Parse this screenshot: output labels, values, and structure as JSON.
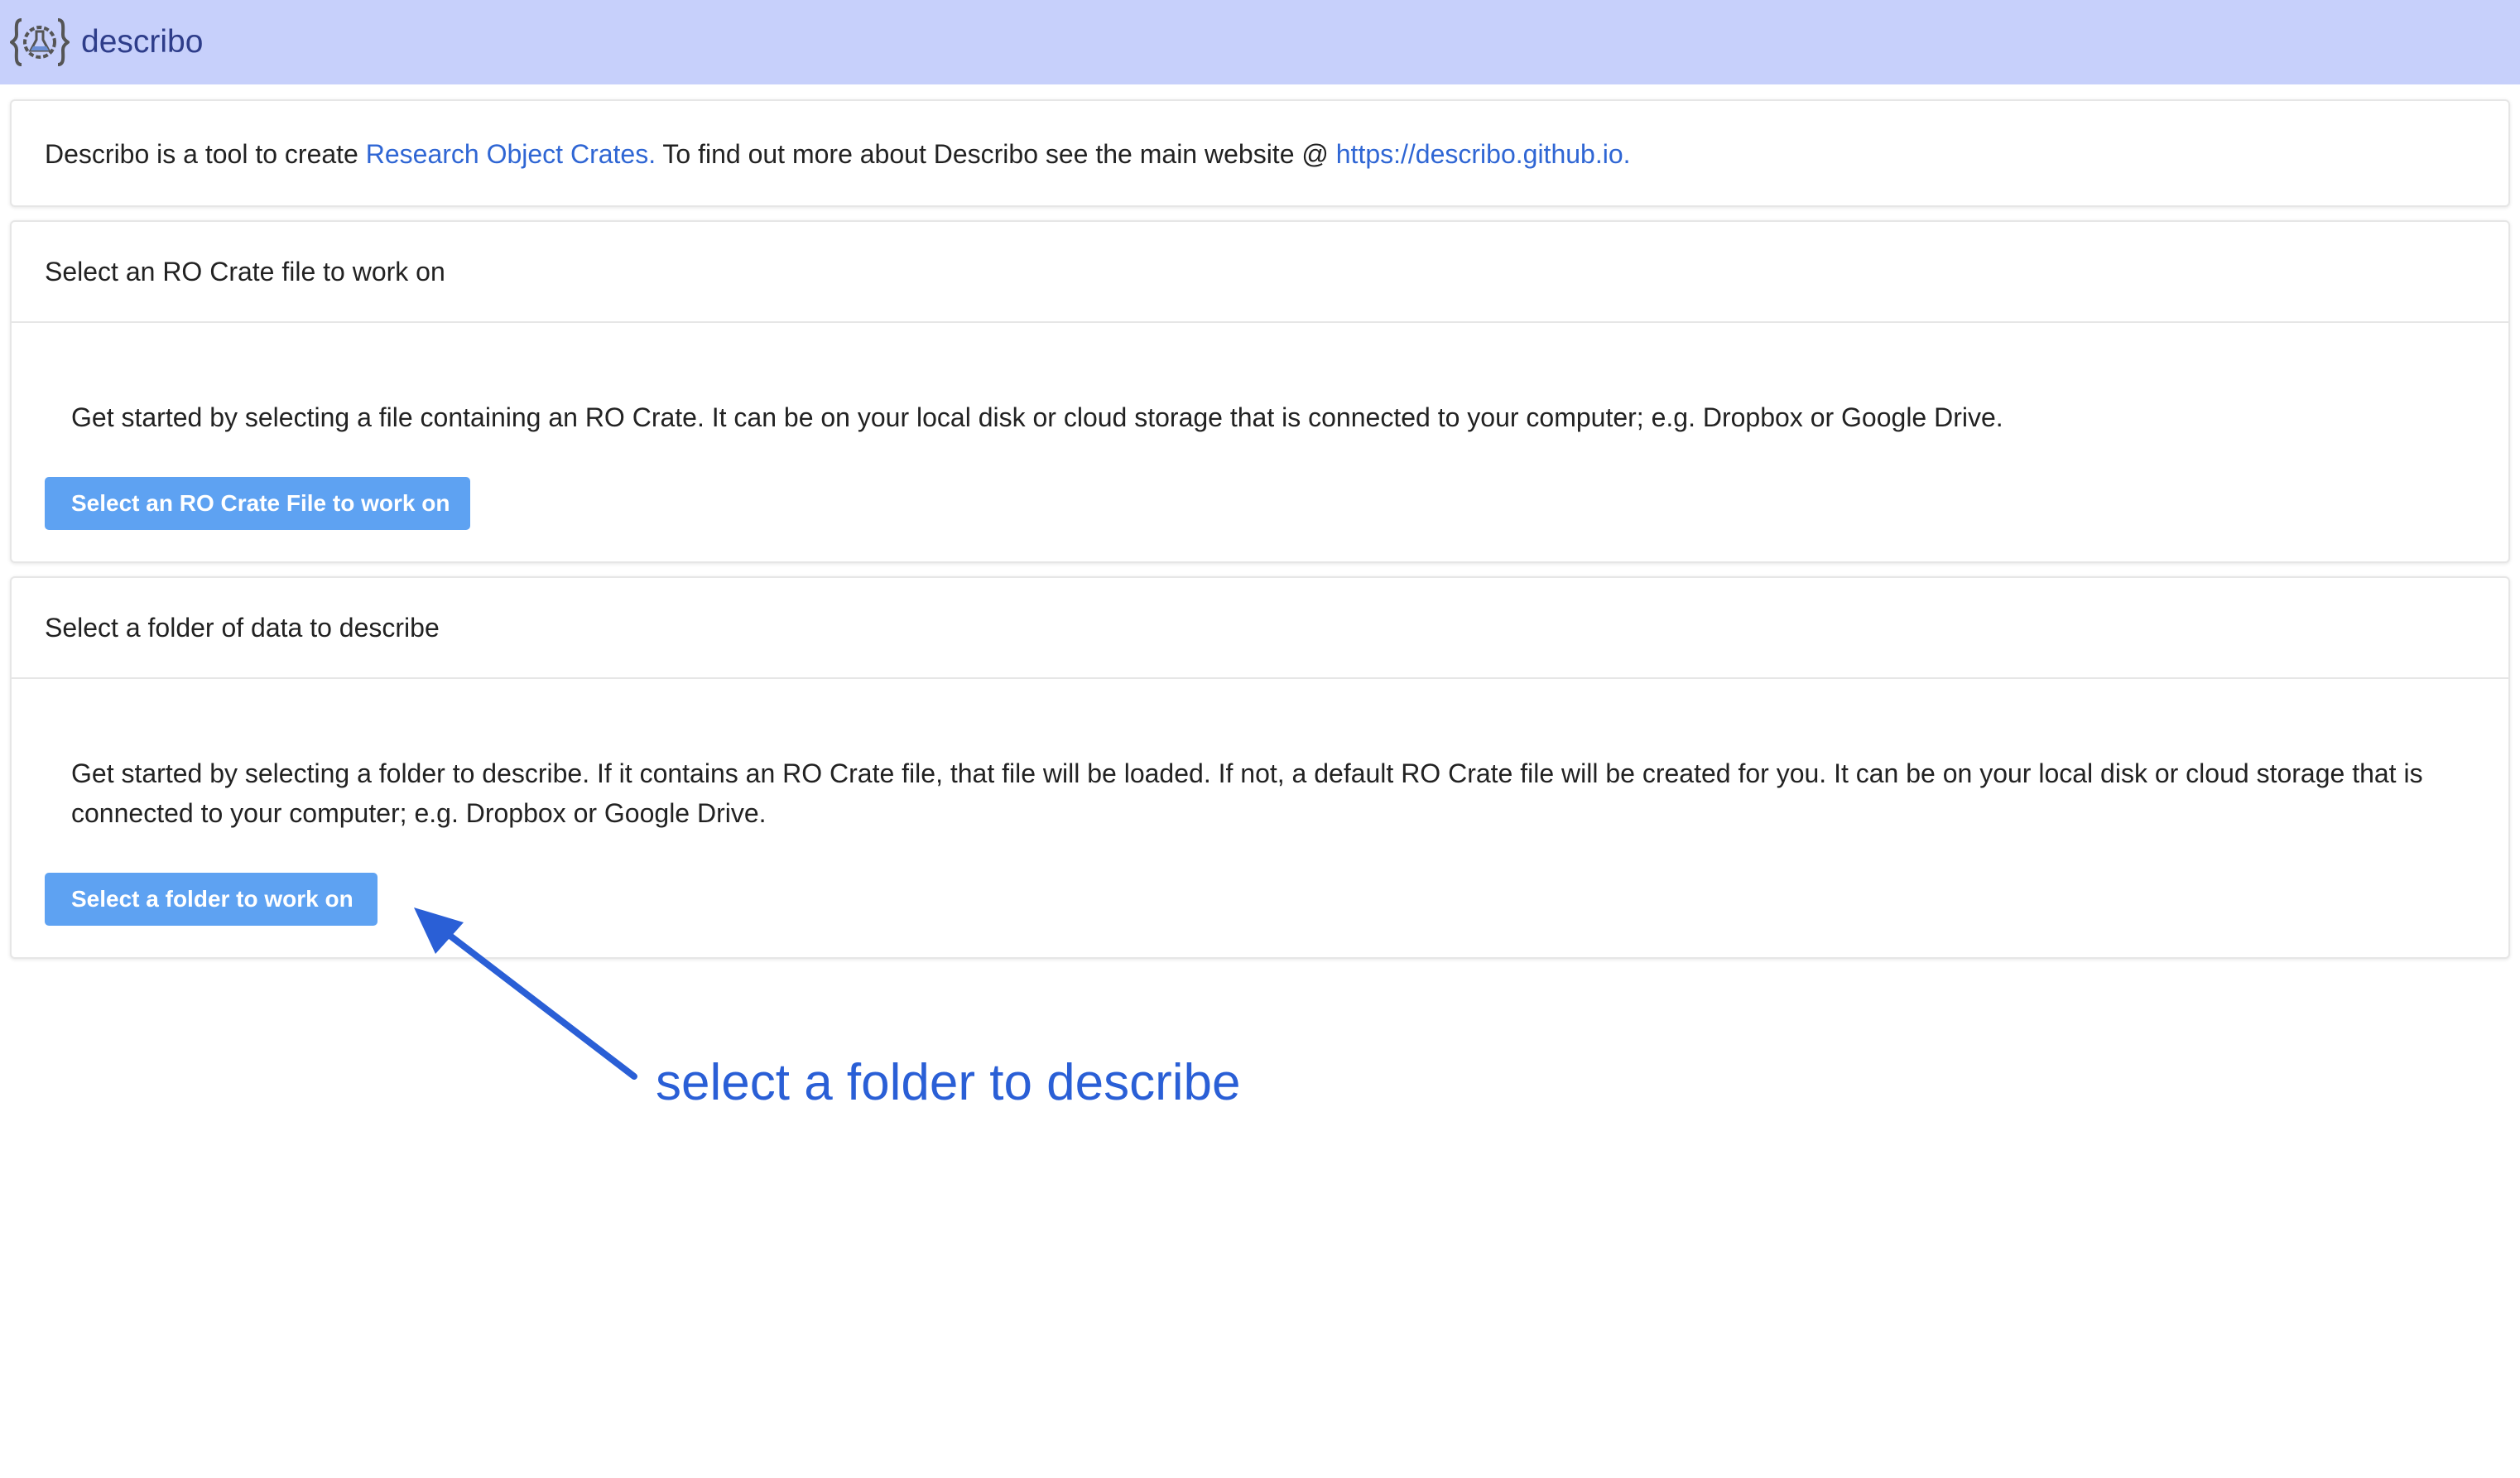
{
  "header": {
    "app_name": "describo",
    "logo_icon": "describo-logo-icon",
    "background": "#c7d0fb"
  },
  "intro": {
    "text_before": "Describo is a tool to create ",
    "link1": "Research Object Crates.",
    "text_middle": " To find out more about Describo see the main website @ ",
    "link2": "https://describo.github.io."
  },
  "crate_card": {
    "title": "Select an RO Crate file to work on",
    "description": "Get started by selecting a file containing an RO Crate. It can be on your local disk or cloud storage that is connected to your computer; e.g. Dropbox or Google Drive.",
    "button_label": "Select an RO Crate File to work on"
  },
  "folder_card": {
    "title": "Select a folder of data to describe",
    "description": "Get started by selecting a folder to describe. If it contains an RO Crate file, that file will be loaded. If not, a default RO Crate file will be created for you. It can be on your local disk or cloud storage that is connected to your computer; e.g. Dropbox or Google Drive.",
    "button_label": "Select a folder to work on"
  },
  "annotation": {
    "text": "select a folder to describe",
    "color": "#2a5fd6"
  },
  "colors": {
    "link": "#2f66d4",
    "button": "#5ea2f2"
  }
}
